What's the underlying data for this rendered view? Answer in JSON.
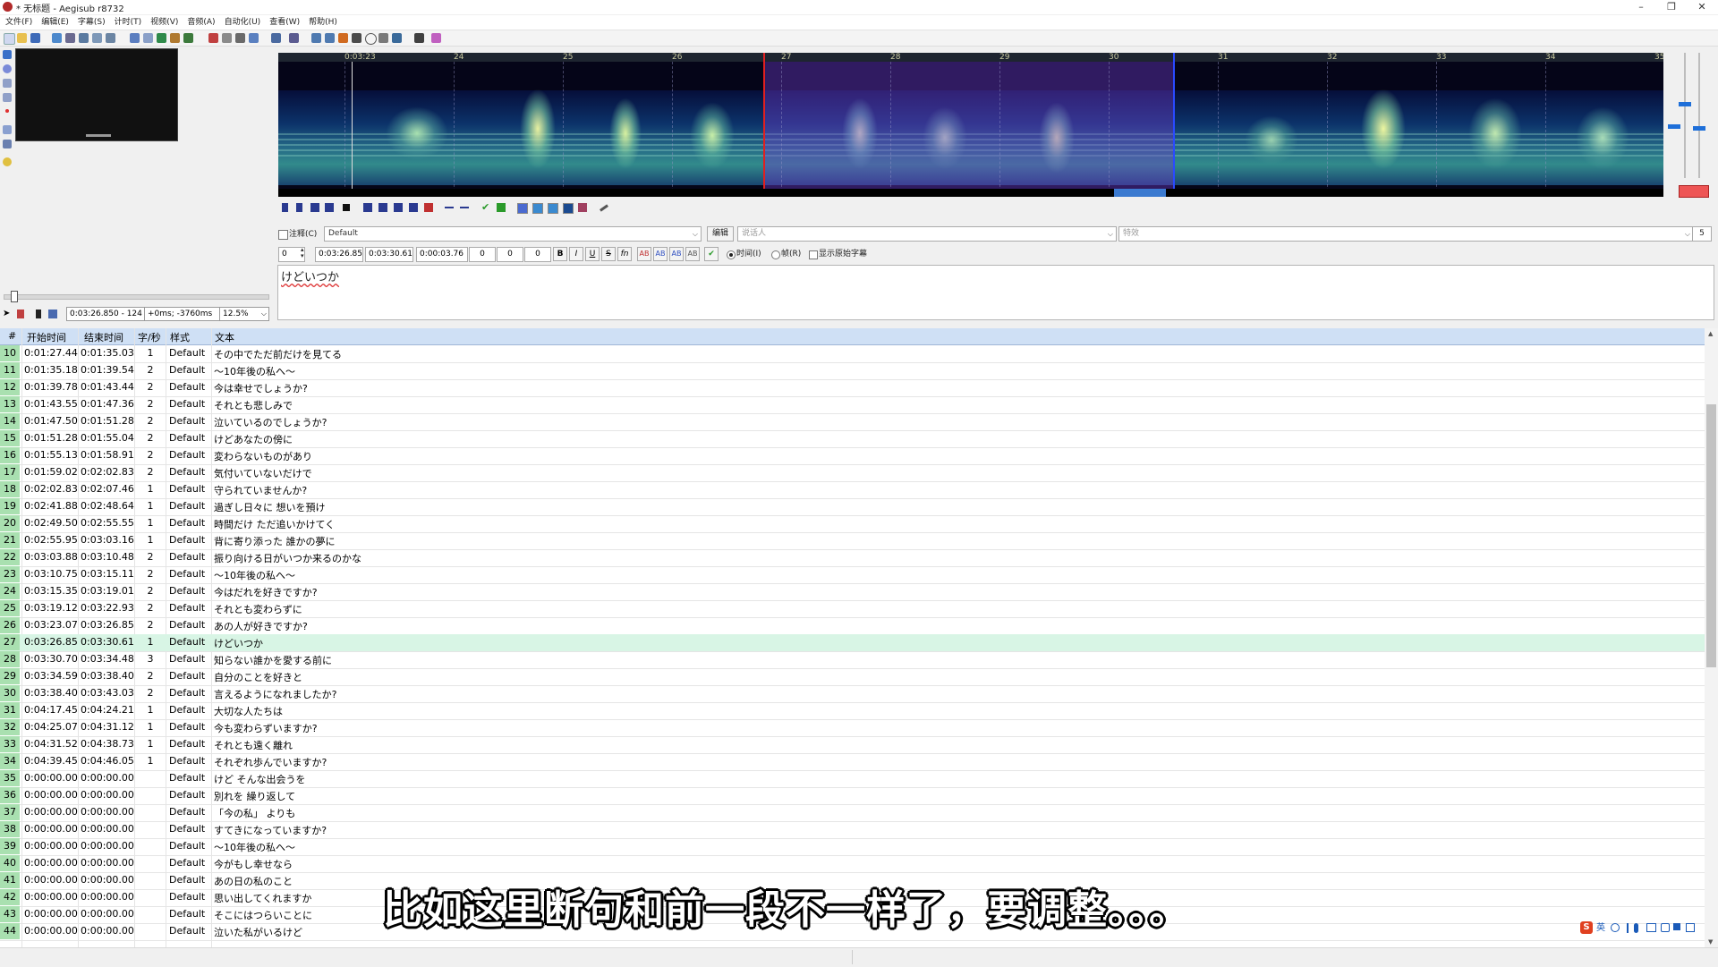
{
  "window": {
    "title": "* 无标题 - Aegisub r8732",
    "minimize": "–",
    "maximize": "❐",
    "close": "✕"
  },
  "menu": [
    "文件(F)",
    "编辑(E)",
    "字幕(S)",
    "计时(T)",
    "视频(V)",
    "音频(A)",
    "自动化(U)",
    "查看(W)",
    "帮助(H)"
  ],
  "video_controls": {
    "time": "0:03:26.850 - 124",
    "offset": "+0ms; -3760ms",
    "zoom": "12.5%"
  },
  "waveform": {
    "ticks": [
      "0:03:23",
      "24",
      "25",
      "26",
      "27",
      "28",
      "29",
      "30",
      "31",
      "32",
      "33",
      "34",
      "35"
    ]
  },
  "edit": {
    "comment_label": "注释(C)",
    "style": "Default",
    "edit_button": "编辑",
    "actor_placeholder": "说话人",
    "effect_placeholder": "特效",
    "char_count": "5",
    "layer": "0",
    "start": "0:03:26.85",
    "end": "0:03:30.61",
    "duration": "0:00:03.76",
    "margin_l": "0",
    "margin_r": "0",
    "margin_v": "0",
    "bold": "B",
    "italic": "I",
    "underline": "U",
    "strike": "S",
    "font": "fn",
    "color1": "AB",
    "color2": "AB",
    "color3": "AB",
    "color4": "AB",
    "time_label": "时间(I)",
    "frame_label": "帧(R)",
    "show_original_label": "显示原始字幕",
    "text": "けどいつか"
  },
  "grid": {
    "headers": {
      "num": "#",
      "start": "开始时间",
      "end": "结束时间",
      "cps": "字/秒",
      "style": "样式",
      "text": "文本"
    },
    "active_row": 27,
    "rows": [
      {
        "num": "10",
        "start": "0:01:27.44",
        "end": "0:01:35.03",
        "cps": "1",
        "style": "Default",
        "text": "その中でただ前だけを見てる"
      },
      {
        "num": "11",
        "start": "0:01:35.18",
        "end": "0:01:39.54",
        "cps": "2",
        "style": "Default",
        "text": "～10年後の私へ～"
      },
      {
        "num": "12",
        "start": "0:01:39.78",
        "end": "0:01:43.44",
        "cps": "2",
        "style": "Default",
        "text": "今は幸せでしょうか?"
      },
      {
        "num": "13",
        "start": "0:01:43.55",
        "end": "0:01:47.36",
        "cps": "2",
        "style": "Default",
        "text": "それとも悲しみで"
      },
      {
        "num": "14",
        "start": "0:01:47.50",
        "end": "0:01:51.28",
        "cps": "2",
        "style": "Default",
        "text": "泣いているのでしょうか?"
      },
      {
        "num": "15",
        "start": "0:01:51.28",
        "end": "0:01:55.04",
        "cps": "2",
        "style": "Default",
        "text": "けどあなたの傍に"
      },
      {
        "num": "16",
        "start": "0:01:55.13",
        "end": "0:01:58.91",
        "cps": "2",
        "style": "Default",
        "text": "変わらないものがあり"
      },
      {
        "num": "17",
        "start": "0:01:59.02",
        "end": "0:02:02.83",
        "cps": "2",
        "style": "Default",
        "text": "気付いていないだけで"
      },
      {
        "num": "18",
        "start": "0:02:02.83",
        "end": "0:02:07.46",
        "cps": "1",
        "style": "Default",
        "text": "守られていませんか?"
      },
      {
        "num": "19",
        "start": "0:02:41.88",
        "end": "0:02:48.64",
        "cps": "1",
        "style": "Default",
        "text": "過ぎし日々に 想いを預け"
      },
      {
        "num": "20",
        "start": "0:02:49.50",
        "end": "0:02:55.55",
        "cps": "1",
        "style": "Default",
        "text": "時間だけ ただ追いかけてく"
      },
      {
        "num": "21",
        "start": "0:02:55.95",
        "end": "0:03:03.16",
        "cps": "1",
        "style": "Default",
        "text": "背に寄り添った 誰かの夢に"
      },
      {
        "num": "22",
        "start": "0:03:03.88",
        "end": "0:03:10.48",
        "cps": "2",
        "style": "Default",
        "text": "振り向ける日がいつか来るのかな"
      },
      {
        "num": "23",
        "start": "0:03:10.75",
        "end": "0:03:15.11",
        "cps": "2",
        "style": "Default",
        "text": "～10年後の私へ～"
      },
      {
        "num": "24",
        "start": "0:03:15.35",
        "end": "0:03:19.01",
        "cps": "2",
        "style": "Default",
        "text": "今はだれを好きですか?"
      },
      {
        "num": "25",
        "start": "0:03:19.12",
        "end": "0:03:22.93",
        "cps": "2",
        "style": "Default",
        "text": "それとも変わらずに"
      },
      {
        "num": "26",
        "start": "0:03:23.07",
        "end": "0:03:26.85",
        "cps": "2",
        "style": "Default",
        "text": "あの人が好きですか?"
      },
      {
        "num": "27",
        "start": "0:03:26.85",
        "end": "0:03:30.61",
        "cps": "1",
        "style": "Default",
        "text": "けどいつか"
      },
      {
        "num": "28",
        "start": "0:03:30.70",
        "end": "0:03:34.48",
        "cps": "3",
        "style": "Default",
        "text": "知らない誰かを愛する前に"
      },
      {
        "num": "29",
        "start": "0:03:34.59",
        "end": "0:03:38.40",
        "cps": "2",
        "style": "Default",
        "text": "自分のことを好きと"
      },
      {
        "num": "30",
        "start": "0:03:38.40",
        "end": "0:03:43.03",
        "cps": "2",
        "style": "Default",
        "text": "言えるようになれましたか?"
      },
      {
        "num": "31",
        "start": "0:04:17.45",
        "end": "0:04:24.21",
        "cps": "1",
        "style": "Default",
        "text": "大切な人たちは"
      },
      {
        "num": "32",
        "start": "0:04:25.07",
        "end": "0:04:31.12",
        "cps": "1",
        "style": "Default",
        "text": "今も変わらずいますか?"
      },
      {
        "num": "33",
        "start": "0:04:31.52",
        "end": "0:04:38.73",
        "cps": "1",
        "style": "Default",
        "text": "それとも遠く離れ"
      },
      {
        "num": "34",
        "start": "0:04:39.45",
        "end": "0:04:46.05",
        "cps": "1",
        "style": "Default",
        "text": "それぞれ歩んでいますか?"
      },
      {
        "num": "35",
        "start": "0:00:00.00",
        "end": "0:00:00.00",
        "cps": "",
        "style": "Default",
        "text": "けど そんな出会うを"
      },
      {
        "num": "36",
        "start": "0:00:00.00",
        "end": "0:00:00.00",
        "cps": "",
        "style": "Default",
        "text": "別れを 繰り返して"
      },
      {
        "num": "37",
        "start": "0:00:00.00",
        "end": "0:00:00.00",
        "cps": "",
        "style": "Default",
        "text": "「今の私」 よりも"
      },
      {
        "num": "38",
        "start": "0:00:00.00",
        "end": "0:00:00.00",
        "cps": "",
        "style": "Default",
        "text": "すてきになっていますか?"
      },
      {
        "num": "39",
        "start": "0:00:00.00",
        "end": "0:00:00.00",
        "cps": "",
        "style": "Default",
        "text": "～10年後の私へ～"
      },
      {
        "num": "40",
        "start": "0:00:00.00",
        "end": "0:00:00.00",
        "cps": "",
        "style": "Default",
        "text": "今がもし幸せなら"
      },
      {
        "num": "41",
        "start": "0:00:00.00",
        "end": "0:00:00.00",
        "cps": "",
        "style": "Default",
        "text": "あの日の私のこと"
      },
      {
        "num": "42",
        "start": "0:00:00.00",
        "end": "0:00:00.00",
        "cps": "",
        "style": "Default",
        "text": "思い出してくれますか"
      },
      {
        "num": "43",
        "start": "0:00:00.00",
        "end": "0:00:00.00",
        "cps": "",
        "style": "Default",
        "text": "そこにはつらいことに"
      },
      {
        "num": "44",
        "start": "0:00:00.00",
        "end": "0:00:00.00",
        "cps": "",
        "style": "Default",
        "text": "泣いた私がいるけど"
      }
    ]
  },
  "overlay_subtitle": "比如这里断句和前一段不一样了，要调整。。。",
  "tray": {
    "ime_label": "英"
  },
  "colors": {
    "grid_header": "#cfe0f5",
    "row_number": "#a9e0b0",
    "active_row": "#d8f5e5",
    "selection": "#6e3cc8",
    "left_marker": "#e02020",
    "right_marker": "#2a4aff"
  }
}
